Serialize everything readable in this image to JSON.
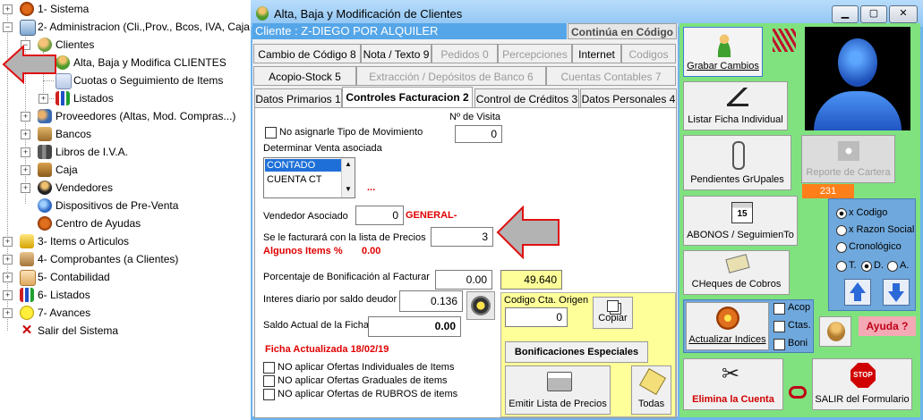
{
  "tree": {
    "sistema": "1- Sistema",
    "administracion": "2- Administracion (Cli.,Prov., Bcos, IVA, Caja",
    "clientes": "Clientes",
    "alta_baja": "Alta, Baja y Modifica CLIENTES",
    "cuotas": "Cuotas o Seguimiento de Items",
    "listados_sub": "Listados",
    "proveedores": "Proveedores (Altas, Mod. Compras...)",
    "bancos": "Bancos",
    "libros_iva": "Libros de I.V.A.",
    "caja": "Caja",
    "vendedores": "Vendedores",
    "dispositivos": "Dispositivos de Pre-Venta",
    "centro_ayudas": "Centro de Ayudas",
    "items": "3- Items o Articulos",
    "comprobantes": "4- Comprobantes (a Clientes)",
    "contabilidad": "5- Contabilidad",
    "listados": "6- Listados",
    "avances": "7- Avances",
    "salir": "Salir del Sistema"
  },
  "window": {
    "title": "Alta, Baja y Modificación de Clientes",
    "client_label": "Cliente : Z-DIEGO POR ALQUILER",
    "continua": "Continúa en Código"
  },
  "top_tabs": {
    "codigo_barra": "Cambio de Código 8",
    "nota": "Nota / Texto 9",
    "pedidos": "Pedidos 0",
    "percepciones": "Percepciones",
    "internet": "Internet",
    "codigos": "Codigos",
    "acopio": "Acopio-Stock 5",
    "extraccion": "Extracción / Depósitos de Banco 6",
    "cuentas_contables": "Cuentas Contables 7"
  },
  "tabs": {
    "datos_primarios": "Datos Primarios 1",
    "controles": "Controles Facturacion 2",
    "control_creditos": "Control de Créditos 3",
    "datos_personales": "Datos Personales 4"
  },
  "form": {
    "no_asignar": "No asignarle Tipo de Movimiento",
    "nro_visita_label": "Nº de Visita",
    "nro_visita": "0",
    "venta_asociada_label": "Determinar Venta asociada",
    "venta_options": [
      "CONTADO",
      "CUENTA CT"
    ],
    "ellipsis": "...",
    "vendedor_label": "Vendedor Asociado",
    "vendedor_value": "0",
    "vendedor_name": "GENERAL-",
    "lista_label": "Se le facturará con la lista de Precios",
    "lista_value": "3",
    "algunos_label": "Algunos Items %",
    "algunos_value": "0.00",
    "bonif_label": "Porcentaje de Bonificación al Facturar",
    "bonif_value": "0.00",
    "bonif_total": "49.640",
    "interes_label": "Interes diario por saldo deudor",
    "interes_value": "0.136",
    "saldo_label": "Saldo Actual de la Ficha",
    "saldo_value": "0.00",
    "ficha_actualizada": "Ficha Actualizada 18/02/19",
    "ofertas_individuales": "NO aplicar Ofertas Individuales de Items",
    "ofertas_graduales": "NO aplicar Ofertas Graduales de items",
    "ofertas_rubros": "NO aplicar Ofertas de RUBROS de items"
  },
  "yellow_panel": {
    "codigo_cta_label": "Codigo Cta. Origen",
    "codigo_cta_value": "0",
    "copiar": "Copiar",
    "bonif_especiales": "Bonificaciones Especiales",
    "emitir_lista": "Emitir Lista de Precios",
    "todas": "Todas"
  },
  "side": {
    "grabar": "Grabar Cambios",
    "listar_ficha": "Listar Ficha Individual",
    "pendientes": "Pendientes GrUpales",
    "reporte_cartera": "Reporte de Cartera",
    "count": "231",
    "abonos": "ABONOS / SeguimienTo",
    "cheques": "CHeques de Cobros",
    "actualizar": "Actualizar Indices",
    "acop": "Acop",
    "ctas": "Ctas.",
    "boni": "Boni",
    "ayuda": "Ayuda ?",
    "elimina": "Elimina la Cuenta",
    "salir": "SALIR del Formulario",
    "radio_codigo": "x Codigo",
    "radio_razon": "x Razon Social",
    "radio_crono": "Cronológico",
    "radio_t": "T.",
    "radio_d": "D.",
    "radio_a": "A."
  },
  "colors": {
    "window_blue": "#6fb4ef",
    "side_green": "#7fe27f",
    "yellow_panel": "#ffff99",
    "count_orange": "#ff7f1a",
    "radio_blue": "#6fa8dc",
    "ayuda_pink": "#f4a9b5",
    "alert_red": "#e00000"
  }
}
